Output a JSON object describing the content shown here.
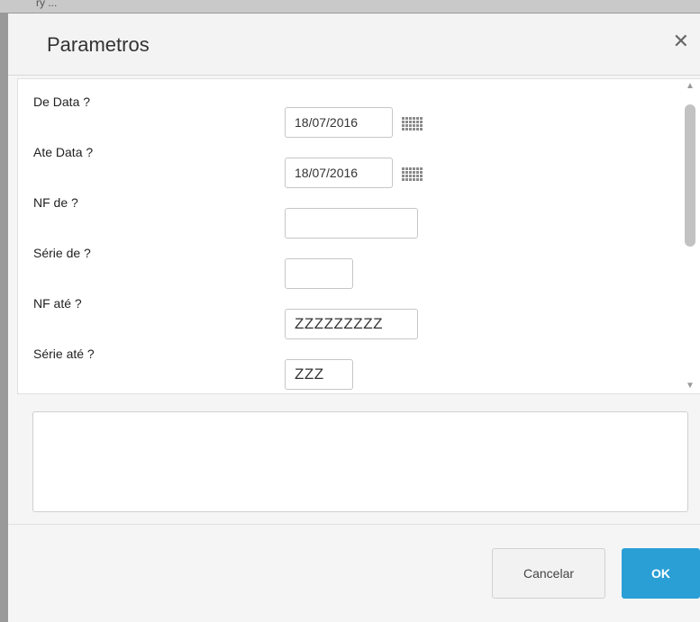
{
  "background_strip": {
    "text": "ry     ..."
  },
  "dialog": {
    "title": "Parametros",
    "close_glyph": "✕"
  },
  "fields": [
    {
      "label": "De Data ?",
      "value": "18/07/2016",
      "has_calendar": true,
      "icon": "calendar-icon"
    },
    {
      "label": "Ate Data ?",
      "value": "18/07/2016",
      "has_calendar": true,
      "icon": "calendar-icon"
    },
    {
      "label": "NF de ?",
      "value": ""
    },
    {
      "label": "Série de ?",
      "value": ""
    },
    {
      "label": "NF até ?",
      "value": "ZZZZZZZZZ"
    },
    {
      "label": "Série até ?",
      "value": "ZZZ"
    }
  ],
  "scrollbar": {
    "up_glyph": "▲",
    "down_glyph": "▼",
    "position": 0.0
  },
  "notes_area": {
    "value": ""
  },
  "buttons": {
    "cancel_label": "Cancelar",
    "ok_label": "OK"
  },
  "colors": {
    "ok_button": "#2a9fd6",
    "backdrop": "#9a9a9a",
    "dialog_bg": "#f5f5f5"
  }
}
